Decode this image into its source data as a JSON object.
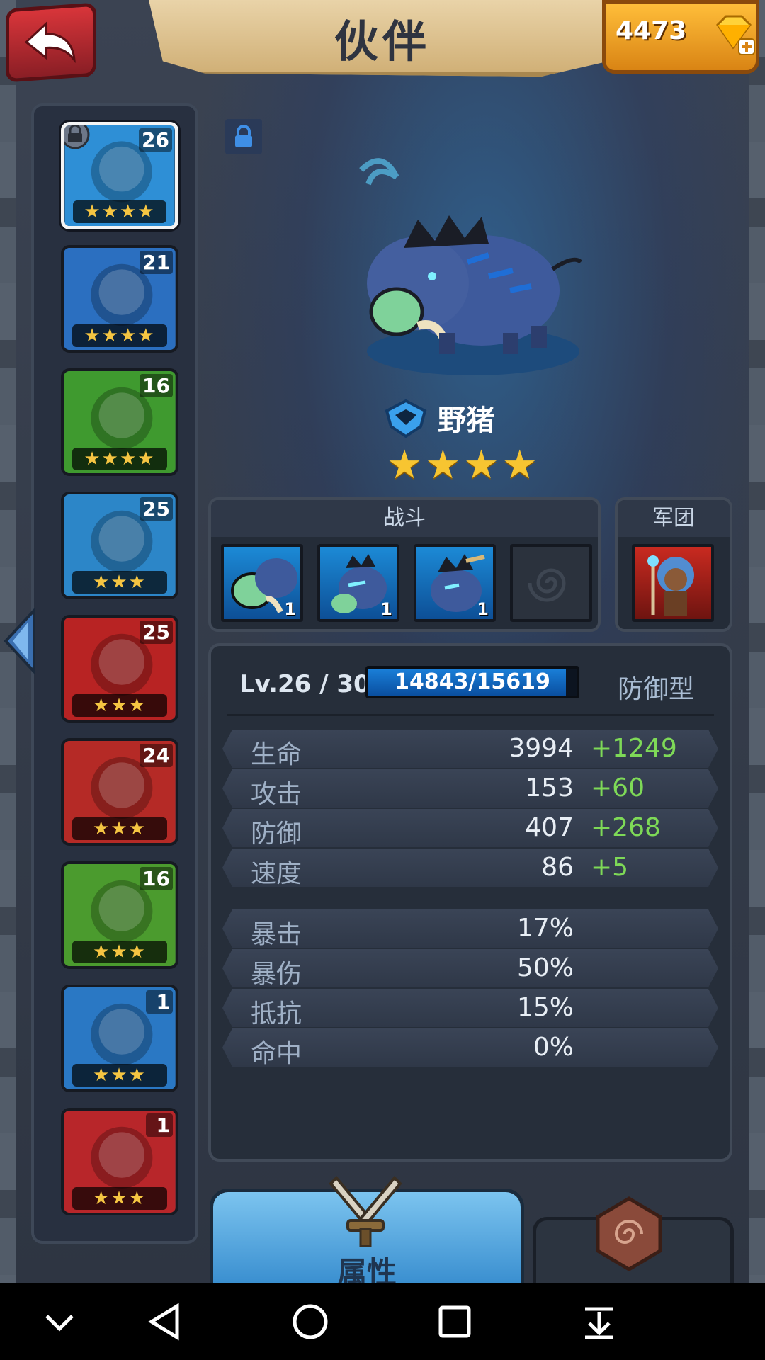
{
  "header": {
    "title": "伙伴",
    "gems": "4473"
  },
  "roster": [
    {
      "level": "26",
      "stars": "★★★★",
      "locked": true,
      "selected": true,
      "color": "#2e8fd6"
    },
    {
      "level": "21",
      "stars": "★★★★",
      "locked": false,
      "selected": false,
      "color": "#2b6fc0"
    },
    {
      "level": "16",
      "stars": "★★★★",
      "locked": false,
      "selected": false,
      "color": "#3f9a2f"
    },
    {
      "level": "25",
      "stars": "★★★",
      "locked": false,
      "selected": false,
      "color": "#2c86c8"
    },
    {
      "level": "25",
      "stars": "★★★",
      "locked": false,
      "selected": false,
      "color": "#b82323"
    },
    {
      "level": "24",
      "stars": "★★★",
      "locked": false,
      "selected": false,
      "color": "#b52a26"
    },
    {
      "level": "16",
      "stars": "★★★",
      "locked": false,
      "selected": false,
      "color": "#4b9b2e"
    },
    {
      "level": "1",
      "stars": "★★★",
      "locked": false,
      "selected": false,
      "color": "#2a78c4"
    },
    {
      "level": "1",
      "stars": "★★★",
      "locked": false,
      "selected": false,
      "color": "#b8262a"
    }
  ],
  "hero": {
    "name": "野猪",
    "stars": "★★★★"
  },
  "battle": {
    "title": "战斗",
    "slots": [
      {
        "qty": "1"
      },
      {
        "qty": "1"
      },
      {
        "qty": "1"
      }
    ]
  },
  "legion": {
    "title": "军团"
  },
  "stats": {
    "level": "Lv.26 / 30",
    "exp": "14843/15619",
    "exp_fraction": 0.95,
    "role": "防御型",
    "rows": [
      {
        "name": "生命",
        "value": "3994",
        "bonus": "+1249"
      },
      {
        "name": "攻击",
        "value": "153",
        "bonus": "+60"
      },
      {
        "name": "防御",
        "value": "407",
        "bonus": "+268"
      },
      {
        "name": "速度",
        "value": "86",
        "bonus": "+5"
      },
      {
        "name": "暴击",
        "value": "17%",
        "bonus": ""
      },
      {
        "name": "暴伤",
        "value": "50%",
        "bonus": ""
      },
      {
        "name": "抵抗",
        "value": "15%",
        "bonus": ""
      },
      {
        "name": "命中",
        "value": "0%",
        "bonus": ""
      }
    ]
  },
  "tabs": {
    "attributes_label": "属性"
  },
  "icons": {
    "back": "back-arrow-icon",
    "gem": "gem-plus-icon",
    "lock": "lock-icon",
    "class": "defense-class-icon",
    "tab_swords": "crossed-swords-icon",
    "tab_rune": "rune-stone-icon"
  }
}
